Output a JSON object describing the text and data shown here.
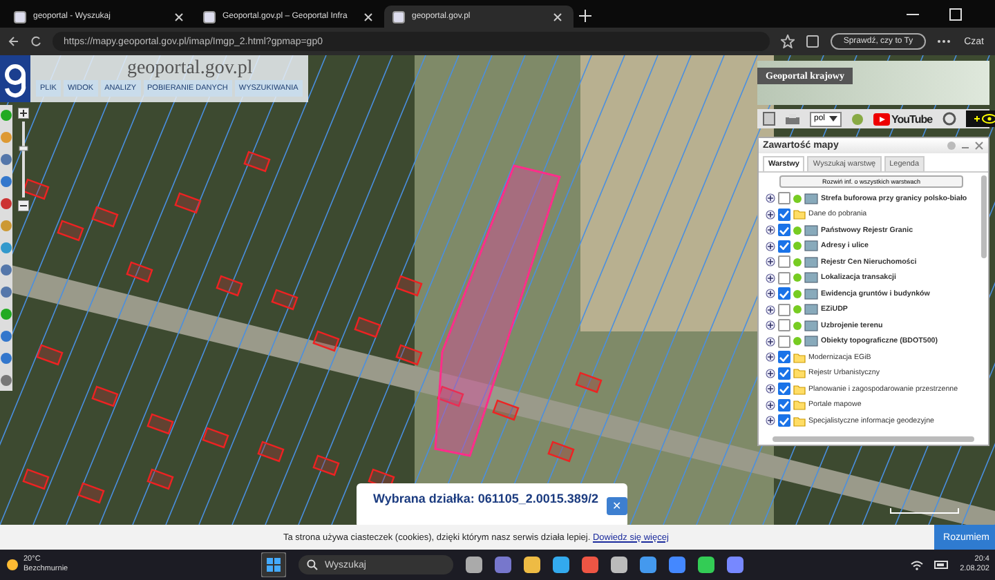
{
  "browser": {
    "tabs": [
      {
        "title": "geoportal - Wyszukaj",
        "selected": false
      },
      {
        "title": "Geoportal.gov.pl – Geoportal Infra",
        "selected": false
      },
      {
        "title": "geoportal.gov.pl",
        "selected": true
      }
    ],
    "url": "https://mapy.geoportal.gov.pl/imap/Imgp_2.html?gpmap=gp0",
    "profile_button": "Sprawdź, czy to Ty",
    "chat": "Czat"
  },
  "header": {
    "logo": "geoportal.gov.pl",
    "menu": [
      "PLIK",
      "WIDOK",
      "ANALIZY",
      "POBIERANIE DANYCH",
      "WYSZUKIWANIA"
    ]
  },
  "overview": {
    "title": "Geoportal krajowy"
  },
  "toolbar": {
    "language": "pol",
    "video": "YouTube"
  },
  "layers_panel": {
    "title": "Zawartość mapy",
    "tabs": [
      {
        "label": "Warstwy",
        "selected": true
      },
      {
        "label": "Wyszukaj warstwę",
        "selected": false
      },
      {
        "label": "Legenda",
        "selected": false
      }
    ],
    "expand_button": "Rozwiń inf. o wszystkich warstwach",
    "layers": [
      {
        "kind": "service",
        "name": "Strefa buforowa przy granicy polsko-biało",
        "checked": false
      },
      {
        "kind": "folder",
        "name": "Dane do pobrania",
        "checked": true
      },
      {
        "kind": "service",
        "name": "Państwowy Rejestr Granic",
        "checked": true
      },
      {
        "kind": "service",
        "name": "Adresy i ulice",
        "checked": true
      },
      {
        "kind": "service",
        "name": "Rejestr Cen Nieruchomości",
        "checked": false
      },
      {
        "kind": "service",
        "name": "Lokalizacja transakcji",
        "checked": false
      },
      {
        "kind": "service",
        "name": "Ewidencja gruntów i budynków",
        "checked": true
      },
      {
        "kind": "service",
        "name": "EZiUDP",
        "checked": false
      },
      {
        "kind": "service",
        "name": "Uzbrojenie terenu",
        "checked": false
      },
      {
        "kind": "service",
        "name": "Obiekty topograficzne (BDOT500)",
        "checked": false
      },
      {
        "kind": "folder",
        "name": "Modernizacja EGiB",
        "checked": true
      },
      {
        "kind": "folder",
        "name": "Rejestr Urbanistyczny",
        "checked": true
      },
      {
        "kind": "folder",
        "name": "Planowanie i zagospodarowanie przestrzenne",
        "checked": true
      },
      {
        "kind": "folder",
        "name": "Portale mapowe",
        "checked": true
      },
      {
        "kind": "folder",
        "name": "Specjalistyczne informacje geodezyjne",
        "checked": true
      }
    ]
  },
  "parcel_popup": {
    "text": "Wybrana działka: 061105_2.0015.389/2",
    "close": "✕"
  },
  "cookie_bar": {
    "text": "Ta strona używa ciasteczek (cookies), dzięki którym nasz serwis działa lepiej.",
    "link": "Dowiedz się więcej",
    "button": "Rozumiem"
  },
  "taskbar": {
    "temperature": "20°C",
    "weather": "Bezchmurnie",
    "search": "Wyszukaj",
    "time": "20:4",
    "date": "2.08.202"
  }
}
